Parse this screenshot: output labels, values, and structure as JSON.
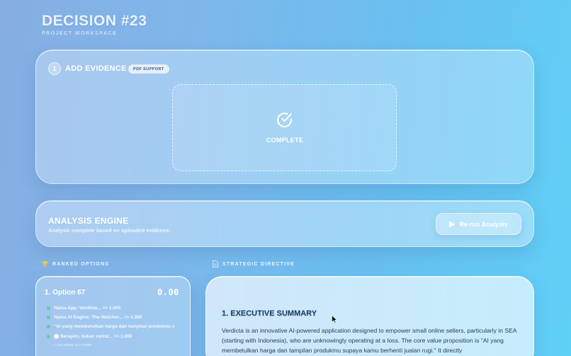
{
  "header": {
    "title": "DECISION #23",
    "subtitle": "PROJECT WORKSPACE"
  },
  "evidence": {
    "step_number": "1",
    "title": "ADD EVIDENCE",
    "badge": "PDF SUPPORT",
    "status_icon": "check-circle-icon",
    "status_label": "COMPLETE"
  },
  "analysis": {
    "title": "ANALYSIS ENGINE",
    "subtitle": "Analysis complete based on uploaded evidence.",
    "rerun_label": "Re-run Analysis",
    "rerun_icon": "play-icon"
  },
  "ranked": {
    "section_label": "RANKED OPTIONS",
    "icon": "trophy-icon",
    "options": [
      {
        "title": "1. Option 67",
        "score": "0.00",
        "items": [
          "Nama App: Verdicta... => 1.000",
          "Nama AI Engine: The Watcher... => 1.000",
          "\"AI yang membetulkan harga dan tampilan produkmu s",
          "⬤ Berapini, bukan netral... => 1.000"
        ],
        "more": "+ 169 MORE FACTORS"
      }
    ]
  },
  "directive": {
    "section_label": "STRATEGIC DIRECTIVE",
    "icon": "document-icon",
    "heading": "1. EXECUTIVE SUMMARY",
    "body": "Verdicta is an innovative AI-powered application designed to empower small online sellers, particularly in SEA (starting with Indonesia), who are unknowingly operating at a loss. The core value proposition is \"AI yang membetulkan harga dan tampilan produkmu supaya kamu berhenti jualan rugi.\" It directly"
  },
  "colors": {
    "accent": "#1c3d66",
    "badge_text": "#3c5a8c",
    "dot": "#5ac8a0"
  }
}
